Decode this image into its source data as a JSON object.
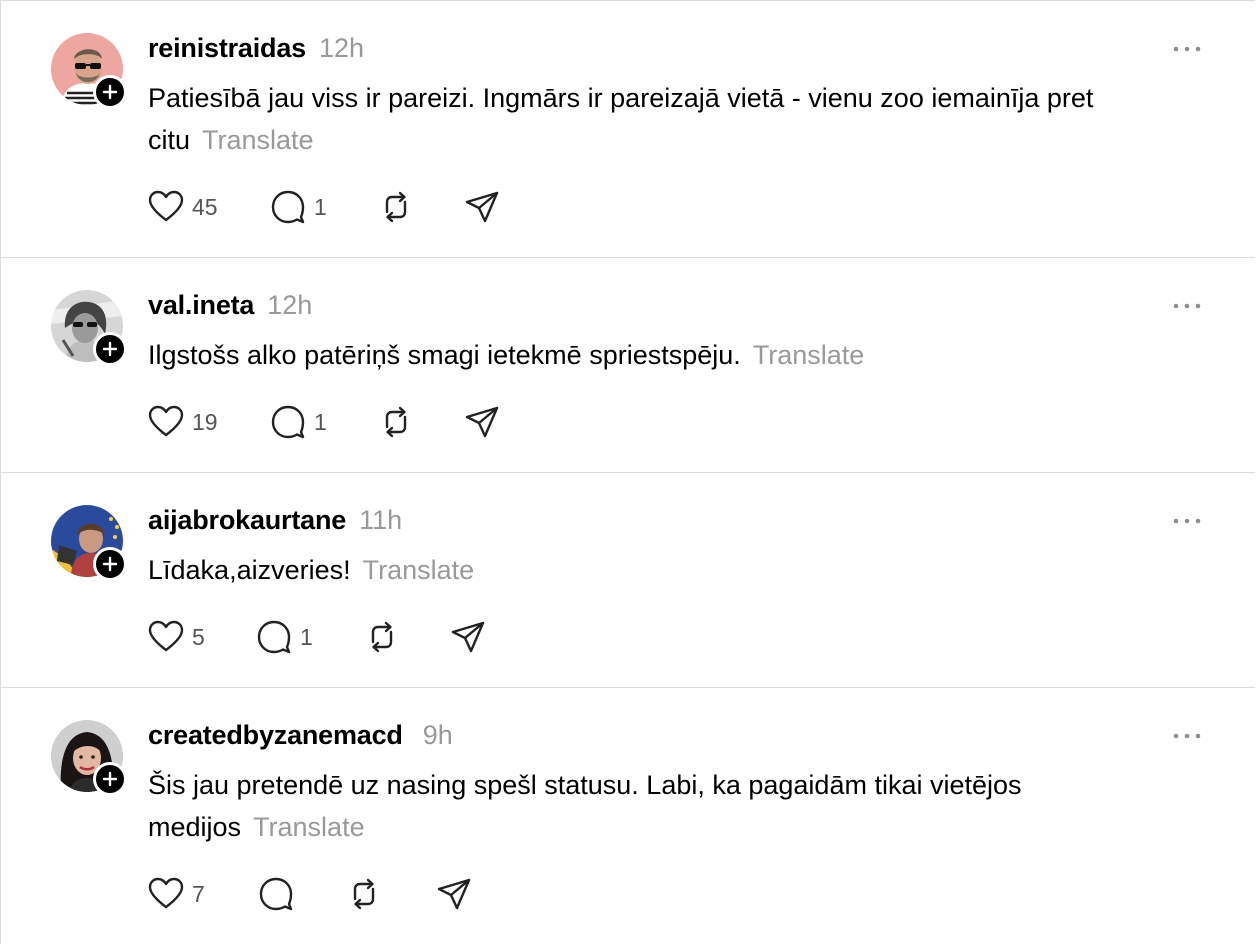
{
  "ui": {
    "translate_label": "Translate",
    "more_icon": "more-horizontal-icon",
    "follow_icon": "plus-icon",
    "action_icons": [
      "heart-icon",
      "comment-icon",
      "repost-icon",
      "share-icon"
    ]
  },
  "colors": {
    "text": "#000000",
    "muted": "#999999",
    "counts": "#555555",
    "divider": "#dbdbdb",
    "badge": "#000000"
  },
  "posts": [
    {
      "username": "reinistraidas",
      "time": "12h",
      "text": "Patiesībā jau viss ir pareizi. Ingmārs ir pareizajā vietā - vienu zoo iemainīja pret citu",
      "likes": "45",
      "comments": "1",
      "reposts": "",
      "shares": ""
    },
    {
      "username": "val.ineta",
      "time": "12h",
      "text": "Ilgstošs alko patēriņš smagi ietekmē spriestspēju.",
      "likes": "19",
      "comments": "1",
      "reposts": "",
      "shares": ""
    },
    {
      "username": "aijabrokaurtane",
      "time": "11h",
      "text": "Līdaka,aizveries!",
      "likes": "5",
      "comments": "1",
      "reposts": "",
      "shares": ""
    },
    {
      "username": "createdbyzanemacd",
      "time": "9h",
      "text": "Šis jau pretendē uz nasing spešl statusu. Labi, ka pagaidām tikai vietējos medijos",
      "likes": "7",
      "comments": "",
      "reposts": "",
      "shares": ""
    }
  ]
}
